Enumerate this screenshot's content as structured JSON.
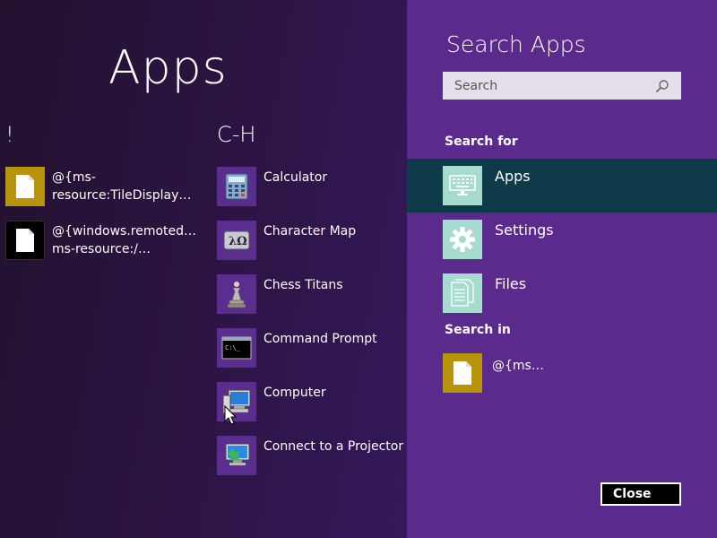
{
  "apps": {
    "title": "Apps",
    "groups": [
      {
        "header": "!",
        "items": [
          {
            "label": "@{ms-\nresource:TileDisplay…",
            "tile": "gold",
            "icon": "document-icon"
          },
          {
            "label": "@{windows.remoted…\nms-resource:/…",
            "tile": "black",
            "icon": "document-icon"
          }
        ]
      },
      {
        "header": "C-H",
        "items": [
          {
            "label": "Calculator",
            "tile": "purple",
            "icon": "calculator-icon"
          },
          {
            "label": "Character Map",
            "tile": "purple",
            "icon": "character-map-icon"
          },
          {
            "label": "Chess Titans",
            "tile": "purple",
            "icon": "chess-icon"
          },
          {
            "label": "Command Prompt",
            "tile": "purple",
            "icon": "command-prompt-icon"
          },
          {
            "label": "Computer",
            "tile": "purple",
            "icon": "computer-icon"
          },
          {
            "label": "Connect to a Projector",
            "tile": "purple",
            "icon": "projector-icon"
          }
        ]
      }
    ]
  },
  "search": {
    "title": "Search Apps",
    "placeholder": "Search",
    "value": "",
    "search_for_label": "Search for",
    "filters": [
      {
        "label": "Apps",
        "icon": "keyboard-icon",
        "selected": true
      },
      {
        "label": "Settings",
        "icon": "gear-icon",
        "selected": false
      },
      {
        "label": "Files",
        "icon": "files-icon",
        "selected": false
      }
    ],
    "search_in_label": "Search in",
    "search_in_item": {
      "label": "@{ms…",
      "icon": "document-icon"
    }
  },
  "close_label": "Close",
  "colors": {
    "apps_background": "#2a1440",
    "search_background": "#5a2a8c",
    "selected_row": "#0f3a4a",
    "filter_tile": "#a6dccf",
    "gold_tile": "#b8940c",
    "purple_tile": "#5b2d8e"
  }
}
